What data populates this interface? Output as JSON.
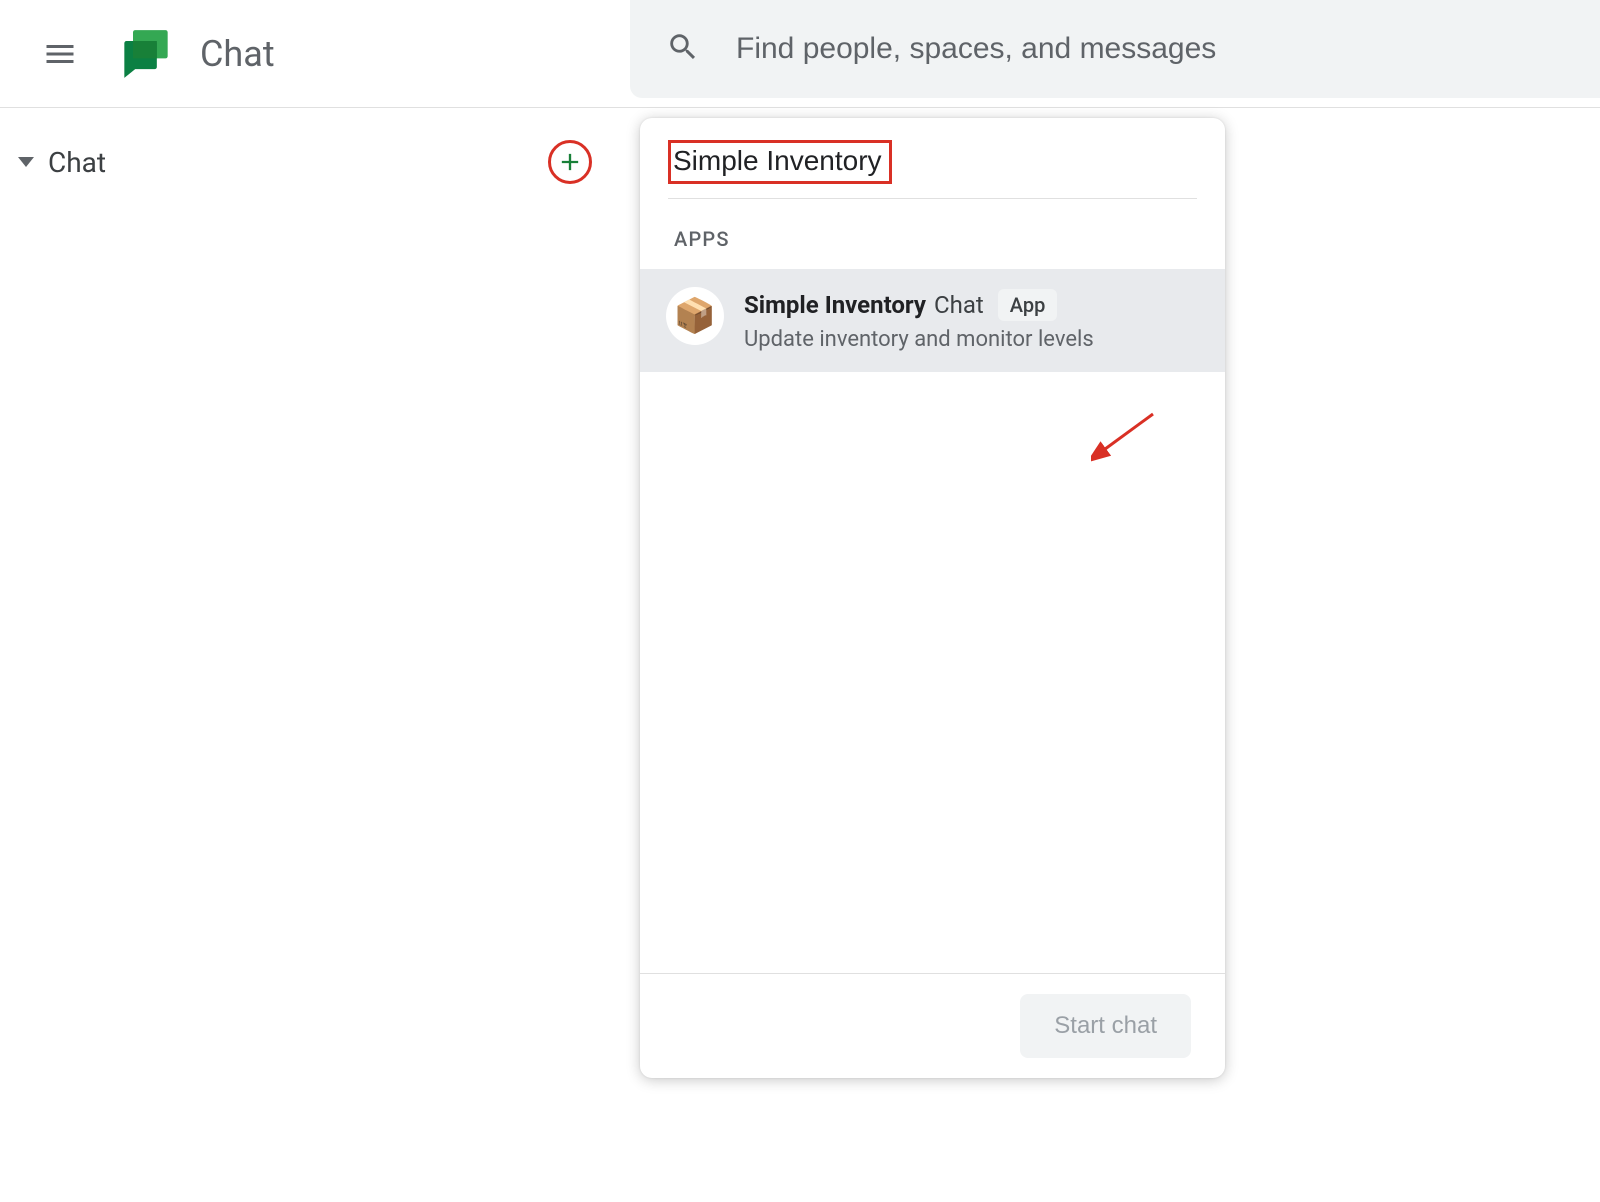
{
  "header": {
    "app_title": "Chat",
    "search_placeholder": "Find people, spaces, and messages"
  },
  "sidebar": {
    "section_label": "Chat"
  },
  "popup": {
    "search_value": "Simple Inventory",
    "apps_section_label": "APPS",
    "result": {
      "name": "Simple Inventory",
      "suffix": "Chat",
      "badge": "App",
      "description": "Update inventory and monitor levels",
      "icon": "📦"
    },
    "start_chat_label": "Start chat"
  }
}
